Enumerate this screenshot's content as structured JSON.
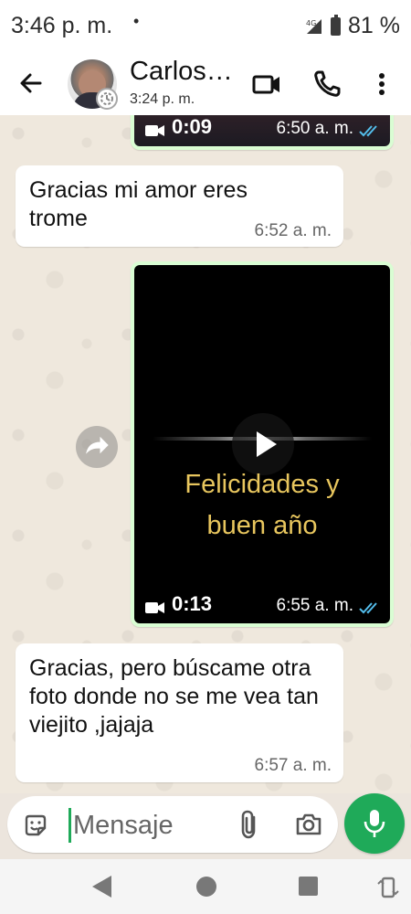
{
  "status_bar": {
    "time": "3:46 p. m.",
    "dot": "•",
    "network": "4G",
    "battery": "81 %"
  },
  "header": {
    "contact_name": "Carlos…",
    "last_seen": "3:24 p. m.",
    "icons": [
      "back-arrow-icon",
      "video-call-icon",
      "phone-icon",
      "more-vert-icon"
    ]
  },
  "messages": [
    {
      "type": "video",
      "direction": "outgoing",
      "duration": "0:09",
      "time": "6:50 a. m.",
      "status": "read"
    },
    {
      "type": "text",
      "direction": "incoming",
      "text": "Gracias mi amor  eres trome",
      "time": "6:52 a. m."
    },
    {
      "type": "video",
      "direction": "outgoing",
      "caption_line1": "Felicidades y",
      "caption_line2": "buen año",
      "duration": "0:13",
      "time": "6:55 a. m.",
      "status": "read"
    },
    {
      "type": "text",
      "direction": "incoming",
      "text": "Gracias, pero búscame otra foto donde no se me vea tan viejito ,jajaja",
      "time": "6:57 a. m."
    }
  ],
  "input": {
    "placeholder": "Mensaje"
  },
  "colors": {
    "accent_green": "#1faa59",
    "outgoing_bubble": "#d9fdd3",
    "read_ticks": "#53bdeb",
    "caption_gold": "#e8c65e"
  }
}
